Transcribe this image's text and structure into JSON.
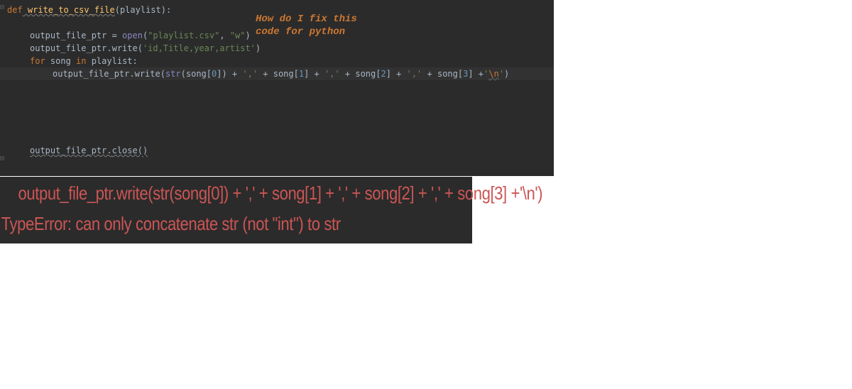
{
  "code": {
    "line1_def": "def",
    "line1_func": " write_to_csv_file",
    "line1_params": "(playlist):",
    "line2_var": "output_file_ptr ",
    "line2_eq": "= ",
    "line2_open": "open",
    "line2_p1": "(",
    "line2_s1": "\"playlist.csv\"",
    "line2_c": ", ",
    "line2_s2": "\"w\"",
    "line2_p2": ")",
    "line3_a": "output_file_ptr.write(",
    "line3_s": "'id,Title,year,artist'",
    "line3_b": ")",
    "line4_for": "for",
    "line4_a": " song ",
    "line4_in": "in",
    "line4_b": " playlist:",
    "line5_a": "output_file_ptr.write(",
    "line5_str": "str",
    "line5_b": "(song[",
    "line5_n0": "0",
    "line5_c": "]) + ",
    "line5_s1": "','",
    "line5_d": " + song[",
    "line5_n1": "1",
    "line5_e": "] + ",
    "line5_s2": "','",
    "line5_f": " + song[",
    "line5_n2": "2",
    "line5_g": "] + ",
    "line5_s3": "','",
    "line5_h": " + song[",
    "line5_n3": "3",
    "line5_i": "] +",
    "line5_s4": "'",
    "line5_esc": "\\n",
    "line5_s5": "'",
    "line5_j": ")",
    "line6_a": "output_file_ptr.",
    "line6_close": "close()"
  },
  "question": {
    "l1": "How do I fix this",
    "l2": "code for python"
  },
  "error": {
    "line1": "output_file_ptr.write(str(song[0]) + ',' + song[1] + ',' + song[2] + ',' + song[3] +'\\n')",
    "line2": "TypeError: can only concatenate str (not \"int\") to str"
  }
}
